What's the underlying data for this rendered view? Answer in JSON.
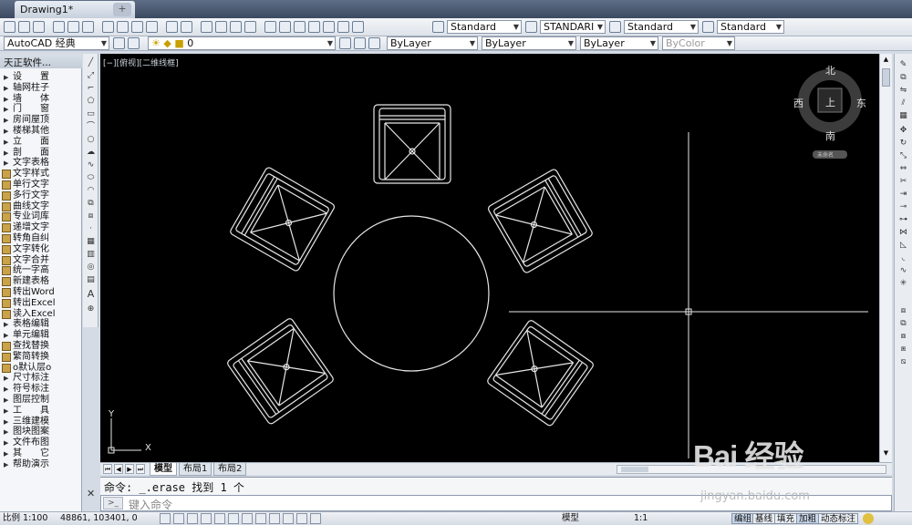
{
  "document": {
    "tab_title": "Drawing1*",
    "close_glyph": "✕",
    "new_tab_glyph": "+"
  },
  "toolbar1": {
    "text_style": "Standard",
    "dim_style": "STANDARI",
    "table_style": "Standard",
    "multileader_style": "Standard"
  },
  "toolbar2": {
    "workspace": "AutoCAD 经典",
    "layer": "0",
    "color": "ByLayer",
    "linetype": "ByLayer",
    "lineweight": "ByLayer",
    "plotstyle": "ByColor"
  },
  "palette": {
    "header": "天正软件...",
    "items": [
      {
        "label": "设　　置",
        "kind": "tri"
      },
      {
        "label": "轴网柱子",
        "kind": "tri"
      },
      {
        "label": "墙　　体",
        "kind": "tri"
      },
      {
        "label": "门　　窗",
        "kind": "tri"
      },
      {
        "label": "房间屋顶",
        "kind": "tri"
      },
      {
        "label": "楼梯其他",
        "kind": "tri"
      },
      {
        "label": "立　　面",
        "kind": "tri"
      },
      {
        "label": "剖　　面",
        "kind": "tri"
      },
      {
        "label": "文字表格",
        "kind": "tri"
      },
      {
        "label": "文字样式",
        "kind": "icon"
      },
      {
        "label": "单行文字",
        "kind": "icon"
      },
      {
        "label": "多行文字",
        "kind": "icon"
      },
      {
        "label": "曲线文字",
        "kind": "icon"
      },
      {
        "label": "专业词库",
        "kind": "icon"
      },
      {
        "label": "递增文字",
        "kind": "icon"
      },
      {
        "label": "转角自纠",
        "kind": "icon"
      },
      {
        "label": "文字转化",
        "kind": "icon"
      },
      {
        "label": "文字合并",
        "kind": "icon"
      },
      {
        "label": "统一字高",
        "kind": "icon"
      },
      {
        "label": "新建表格",
        "kind": "icon"
      },
      {
        "label": "转出Word",
        "kind": "icon"
      },
      {
        "label": "转出Excel",
        "kind": "icon"
      },
      {
        "label": "读入Excel",
        "kind": "icon"
      },
      {
        "label": "表格编辑",
        "kind": "tri"
      },
      {
        "label": "单元编辑",
        "kind": "tri"
      },
      {
        "label": "查找替换",
        "kind": "icon"
      },
      {
        "label": "繁简转换",
        "kind": "icon"
      },
      {
        "label": "o默认层o",
        "kind": "icon"
      },
      {
        "label": "尺寸标注",
        "kind": "tri"
      },
      {
        "label": "符号标注",
        "kind": "tri"
      },
      {
        "label": "图层控制",
        "kind": "tri"
      },
      {
        "label": "工　　具",
        "kind": "tri"
      },
      {
        "label": "三维建模",
        "kind": "tri"
      },
      {
        "label": "图块图案",
        "kind": "tri"
      },
      {
        "label": "文件布图",
        "kind": "tri"
      },
      {
        "label": "其　　它",
        "kind": "tri"
      },
      {
        "label": "帮助演示",
        "kind": "tri"
      }
    ]
  },
  "viewport": {
    "label": "[−][俯视][二维线框]"
  },
  "viewcube": {
    "north": "北",
    "south": "南",
    "east": "东",
    "west": "西",
    "top": "上",
    "wcs": "未命名"
  },
  "ucs": {
    "x": "X",
    "y": "Y"
  },
  "layout_tabs": [
    "模型",
    "布局1",
    "布局2"
  ],
  "command": {
    "history": "命令: _.erase 找到 1 个",
    "placeholder": "键入命令",
    "prompt_icon": ">_"
  },
  "status": {
    "scale": "比例 1:100",
    "coords": "48861, 103401, 0",
    "model_btn": "模型",
    "anno_scale": "1:1",
    "buttons": [
      "编组",
      "基线",
      "填充",
      "加粗",
      "动态标注"
    ]
  },
  "watermark": {
    "text": "Bai 经验",
    "url": "jingyan.baidu.com"
  },
  "colors": {
    "canvas_bg": "#000000",
    "lines": "#e6e6e6",
    "accent": "#3c4a60"
  }
}
